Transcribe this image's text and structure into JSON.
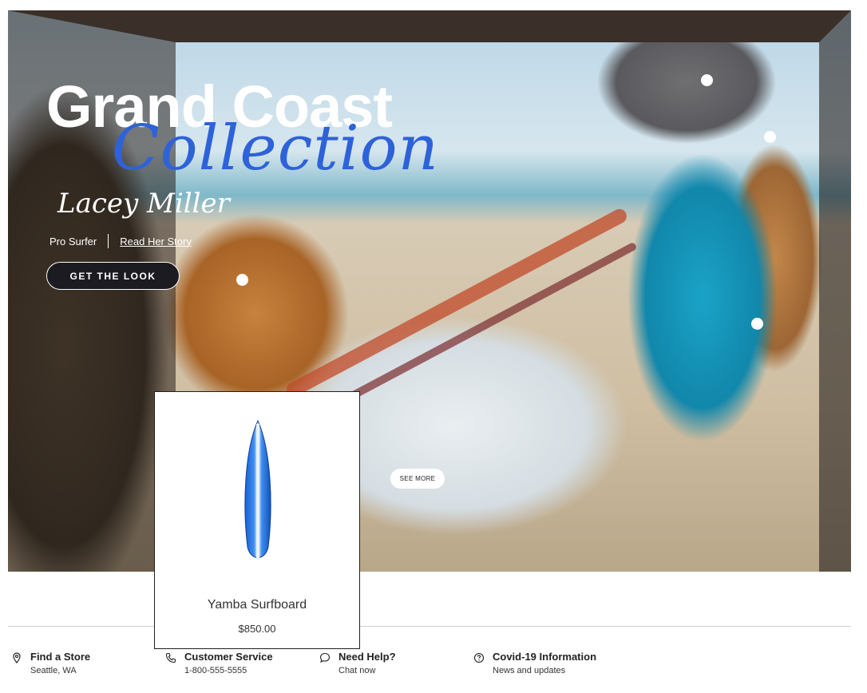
{
  "hero": {
    "title_line1": "Grand Coast",
    "title_line2": "Collection",
    "signature": "Lacey Miller",
    "pro_label": "Pro Surfer",
    "read_story": "Read Her Story",
    "cta": "GET THE LOOK",
    "see_more": "SEE MORE"
  },
  "product": {
    "name": "Yamba Surfboard",
    "price": "$850.00"
  },
  "footer": {
    "items": [
      {
        "title": "Find a Store",
        "sub": "Seattle, WA",
        "icon": "location-pin-icon"
      },
      {
        "title": "Customer Service",
        "sub": "1-800-555-5555",
        "icon": "phone-icon"
      },
      {
        "title": "Need Help?",
        "sub": "Chat now",
        "icon": "chat-bubble-icon"
      },
      {
        "title": "Covid-19 Information",
        "sub": "News and updates",
        "icon": "help-circle-icon"
      }
    ]
  },
  "colors": {
    "accent_script": "#2e62d9",
    "cta_bg": "#1d1b22"
  }
}
